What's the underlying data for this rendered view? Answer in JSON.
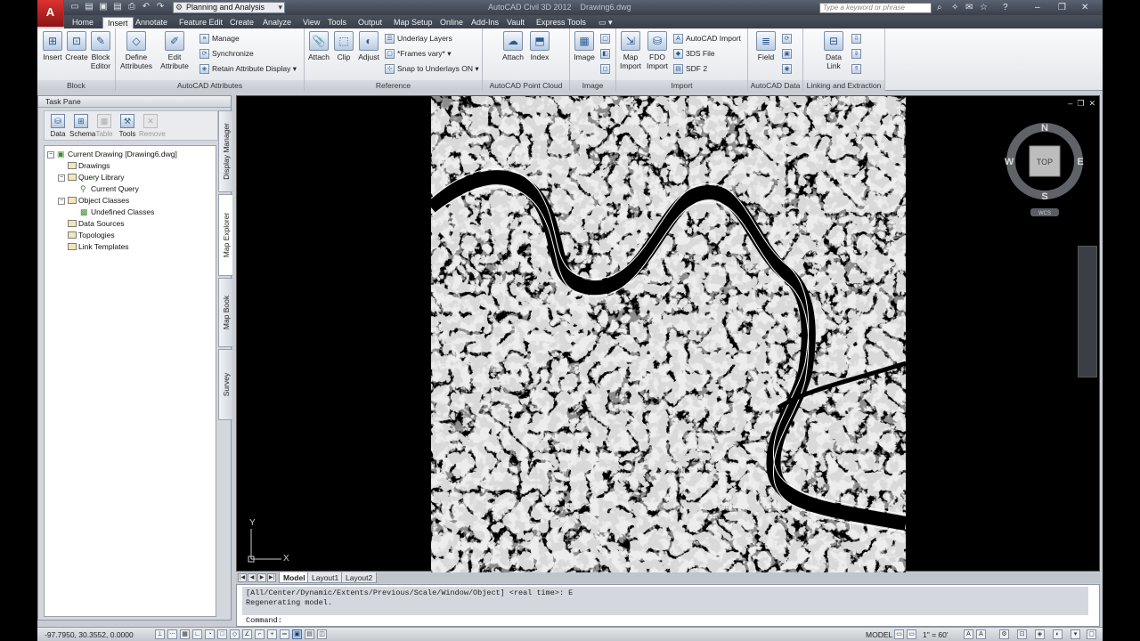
{
  "titlebar": {
    "app_icon": "A",
    "workspace": "Planning and Analysis",
    "app_name": "AutoCAD Civil 3D 2012",
    "file_name": "Drawing6.dwg",
    "search_placeholder": "Type a keyword or phrase"
  },
  "tabs": [
    "Home",
    "Insert",
    "Annotate",
    "Feature Edit",
    "Create",
    "Analyze",
    "View",
    "Tools",
    "Output",
    "Map Setup",
    "Online",
    "Add-Ins",
    "Vault",
    "Express Tools"
  ],
  "active_tab": "Insert",
  "ribbon": {
    "block": {
      "title": "Block",
      "insert": "Insert",
      "create": "Create",
      "block_editor_1": "Block",
      "block_editor_2": "Editor"
    },
    "attributes": {
      "title": "AutoCAD Attributes",
      "define_1": "Define",
      "define_2": "Attributes",
      "edit_1": "Edit",
      "edit_2": "Attribute",
      "manage": "Manage",
      "synchronize": "Synchronize",
      "retain": "Retain Attribute Display"
    },
    "reference": {
      "title": "Reference",
      "attach": "Attach",
      "clip": "Clip",
      "adjust": "Adjust",
      "underlay_layers": "Underlay Layers",
      "frames": "*Frames vary*",
      "snap": "Snap to Underlays ON"
    },
    "pointcloud": {
      "title": "AutoCAD Point Cloud",
      "attach": "Attach",
      "index": "Index"
    },
    "image": {
      "title": "Image",
      "image": "Image"
    },
    "import": {
      "title": "Import",
      "map_1": "Map",
      "map_2": "Import",
      "fdo_1": "FDO",
      "fdo_2": "Import",
      "autocad_import": "AutoCAD Import",
      "threeds": "3DS File",
      "sdf": "SDF 2"
    },
    "data": {
      "title": "AutoCAD Data",
      "field": "Field"
    },
    "linking": {
      "title": "Linking and Extraction",
      "data_1": "Data",
      "data_2": "Link"
    }
  },
  "taskpane": {
    "title": "Task Pane",
    "tools": [
      "Data",
      "Schema",
      "Table",
      "Tools",
      "Remove"
    ],
    "tree": {
      "root": "Current Drawing [Drawing6.dwg]",
      "drawings": "Drawings",
      "query_library": "Query Library",
      "current_query": "Current Query",
      "object_classes": "Object Classes",
      "undefined_classes": "Undefined Classes",
      "data_sources": "Data Sources",
      "topologies": "Topologies",
      "link_templates": "Link Templates"
    },
    "side_tabs": [
      "Display Manager",
      "Map Explorer",
      "Map Book",
      "Survey"
    ]
  },
  "viewcube": {
    "n": "N",
    "s": "S",
    "e": "E",
    "w": "W",
    "top": "TOP",
    "wcs": "WCS"
  },
  "ucs": {
    "x": "X",
    "y": "Y"
  },
  "layout_tabs": [
    "Model",
    "Layout1",
    "Layout2"
  ],
  "command": {
    "line1": "[All/Center/Dynamic/Extents/Previous/Scale/Window/Object] <real time>: E",
    "line2": "Regenerating model.",
    "prompt": "Command:"
  },
  "status": {
    "coords": "-97.7950, 30.3552, 0.0000",
    "model": "MODEL",
    "scale": "1\" = 60'"
  }
}
